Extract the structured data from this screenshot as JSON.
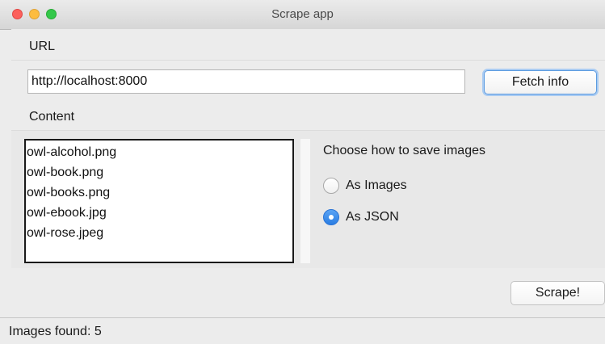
{
  "window": {
    "title": "Scrape app"
  },
  "url_section": {
    "label": "URL",
    "input_value": "http://localhost:8000",
    "fetch_button_label": "Fetch info"
  },
  "content_section": {
    "label": "Content",
    "files": [
      "owl-alcohol.png",
      "owl-book.png",
      "owl-books.png",
      "owl-ebook.jpg",
      "owl-rose.jpeg"
    ],
    "save_options": {
      "heading": "Choose how to save images",
      "options": [
        {
          "label": "As Images",
          "selected": false
        },
        {
          "label": "As JSON",
          "selected": true
        }
      ]
    }
  },
  "actions": {
    "scrape_button_label": "Scrape!"
  },
  "status": {
    "text": "Images found: 5"
  },
  "colors": {
    "accent": "#2a7de2",
    "traffic_close": "#fc605c",
    "traffic_minimize": "#fdbc40",
    "traffic_zoom": "#34c84a"
  },
  "icons": {
    "close": "close-icon",
    "minimize": "minimize-icon",
    "zoom": "zoom-icon"
  }
}
